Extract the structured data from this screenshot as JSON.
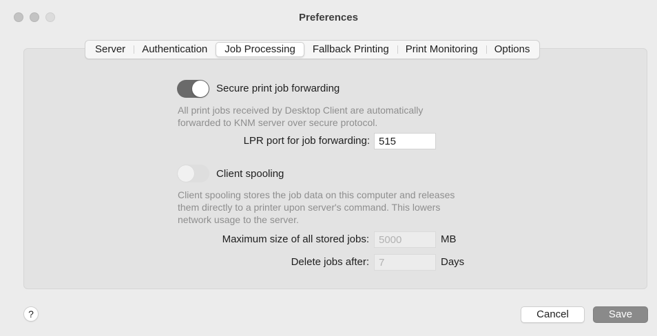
{
  "window": {
    "title": "Preferences"
  },
  "tabs": [
    {
      "label": "Server"
    },
    {
      "label": "Authentication"
    },
    {
      "label": "Job Processing",
      "active": true
    },
    {
      "label": "Fallback Printing"
    },
    {
      "label": "Print Monitoring"
    },
    {
      "label": "Options"
    }
  ],
  "secure_forwarding": {
    "label": "Secure print job forwarding",
    "enabled": true,
    "description_line1": "All print jobs received by Desktop Client are automatically",
    "description_line2": "forwarded to KNM server over secure protocol.",
    "lpr_port_label": "LPR port for job forwarding:",
    "lpr_port_value": "515"
  },
  "client_spooling": {
    "label": "Client spooling",
    "enabled": false,
    "description_line1": "Client spooling stores the job data on this computer and releases",
    "description_line2": "them directly to a printer upon server's command. This lowers",
    "description_line3": "network usage to the server.",
    "max_size_label": "Maximum size of all stored jobs:",
    "max_size_value": "5000",
    "max_size_unit": "MB",
    "delete_after_label": "Delete jobs after:",
    "delete_after_value": "7",
    "delete_after_unit": "Days"
  },
  "footer": {
    "help_label": "?",
    "cancel_label": "Cancel",
    "save_label": "Save"
  },
  "colors": {
    "toggle_on": "#6a6a6a",
    "save_button": "#8a8a8a"
  }
}
